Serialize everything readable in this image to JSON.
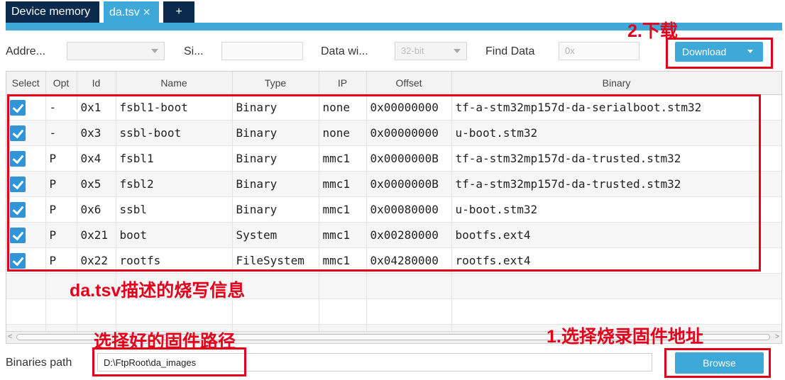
{
  "tabs": [
    {
      "label": "Device memory"
    },
    {
      "label": "da.tsv",
      "close": "✕"
    },
    {
      "label": "+"
    }
  ],
  "toolbar": {
    "address_label": "Addre...",
    "size_label": "Si...",
    "datawidth_label": "Data wi...",
    "datawidth_value": "32-bit",
    "find_label": "Find Data",
    "find_placeholder": "0x",
    "download_label": "Download"
  },
  "table": {
    "columns": [
      "Select",
      "Opt",
      "Id",
      "Name",
      "Type",
      "IP",
      "Offset",
      "Binary"
    ],
    "rows": [
      {
        "opt": "-",
        "id": "0x1",
        "name": "fsbl1-boot",
        "type": "Binary",
        "ip": "none",
        "offset": "0x00000000",
        "binary": "tf-a-stm32mp157d-da-serialboot.stm32"
      },
      {
        "opt": "-",
        "id": "0x3",
        "name": "ssbl-boot",
        "type": "Binary",
        "ip": "none",
        "offset": "0x00000000",
        "binary": "u-boot.stm32"
      },
      {
        "opt": "P",
        "id": "0x4",
        "name": "fsbl1",
        "type": "Binary",
        "ip": "mmc1",
        "offset": "0x0000000B",
        "binary": "tf-a-stm32mp157d-da-trusted.stm32"
      },
      {
        "opt": "P",
        "id": "0x5",
        "name": "fsbl2",
        "type": "Binary",
        "ip": "mmc1",
        "offset": "0x0000000B",
        "binary": "tf-a-stm32mp157d-da-trusted.stm32"
      },
      {
        "opt": "P",
        "id": "0x6",
        "name": "ssbl",
        "type": "Binary",
        "ip": "mmc1",
        "offset": "0x00080000",
        "binary": "u-boot.stm32"
      },
      {
        "opt": "P",
        "id": "0x21",
        "name": "boot",
        "type": "System",
        "ip": "mmc1",
        "offset": "0x00280000",
        "binary": "bootfs.ext4"
      },
      {
        "opt": "P",
        "id": "0x22",
        "name": "rootfs",
        "type": "FileSystem",
        "ip": "mmc1",
        "offset": "0x04280000",
        "binary": "rootfs.ext4"
      }
    ]
  },
  "bottom": {
    "path_label": "Binaries path",
    "path_value": "D:\\FtpRoot\\da_images",
    "browse_label": "Browse"
  },
  "annotations": {
    "download": "2.下载",
    "table_desc": "da.tsv描述的烧写信息",
    "path_desc": "选择好的固件路径",
    "browse_desc": "1.选择烧录固件地址"
  },
  "colors": {
    "accent": "#3ea8d8",
    "tab_dark": "#0b2a4c",
    "checkbox": "#2f95d8",
    "annotation": "#e4001b"
  },
  "icons": {
    "checkbox": "checked-checkbox-icon",
    "dropdown": "chevron-down-icon",
    "close": "close-icon"
  }
}
